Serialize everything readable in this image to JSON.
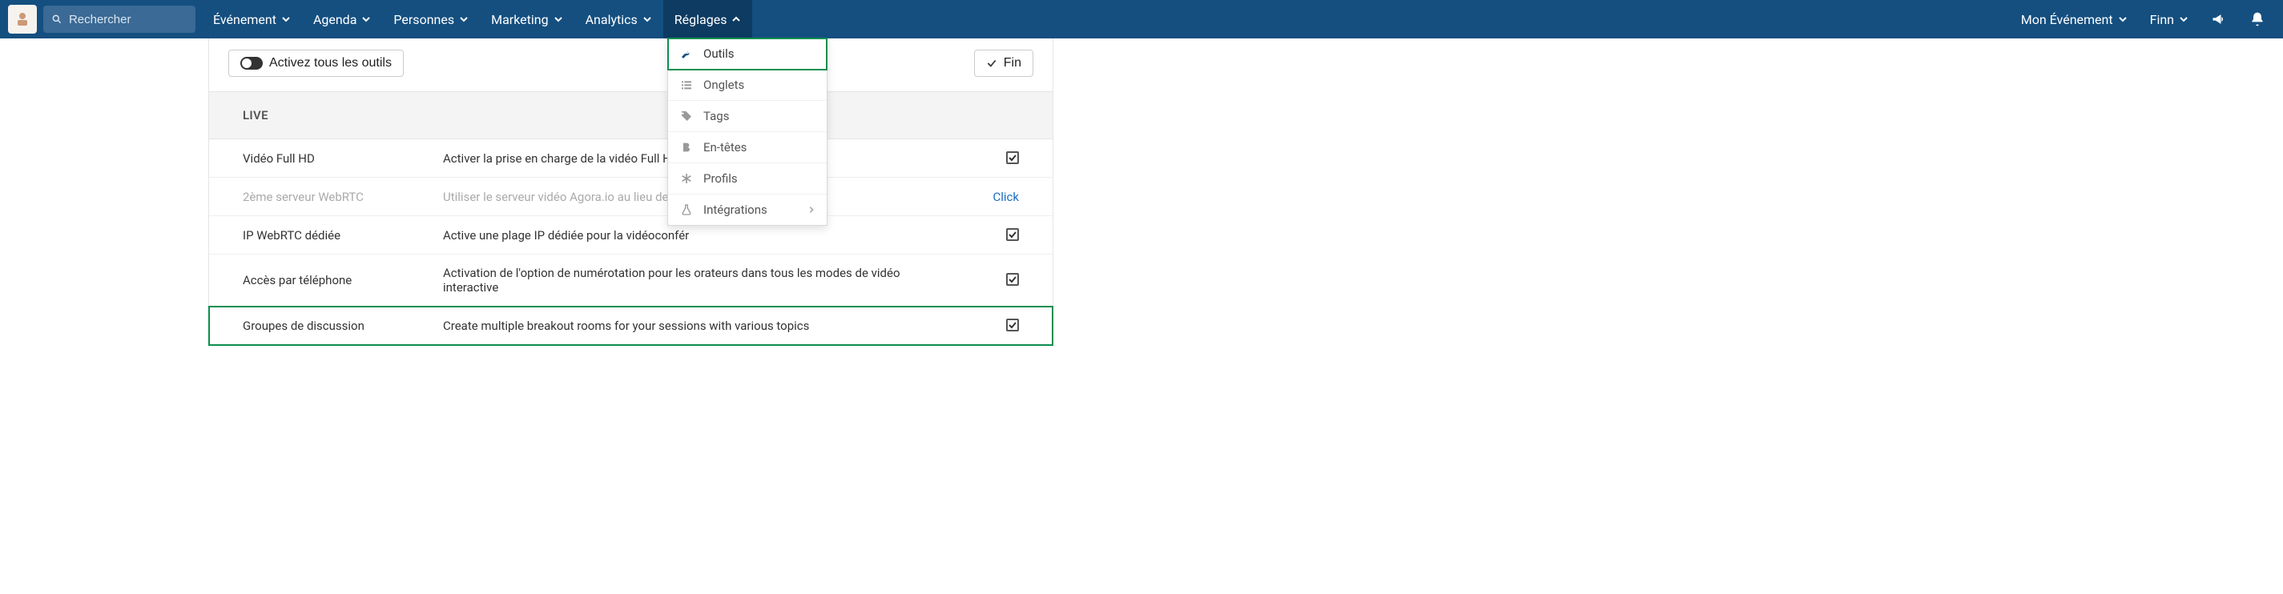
{
  "nav": {
    "search_placeholder": "Rechercher",
    "items": [
      {
        "label": "Événement"
      },
      {
        "label": "Agenda"
      },
      {
        "label": "Personnes"
      },
      {
        "label": "Marketing"
      },
      {
        "label": "Analytics"
      },
      {
        "label": "Réglages"
      }
    ],
    "right": {
      "event": "Mon Événement",
      "user": "Finn"
    }
  },
  "toolbar": {
    "activate_all": "Activez tous les outils",
    "finish": "Fin"
  },
  "section_title": "LIVE",
  "rows": [
    {
      "name": "Vidéo Full HD",
      "desc": "Activer la prise en charge de la vidéo Full HD p                                            virtuel",
      "checked": true
    },
    {
      "name": "2ème serveur WebRTC",
      "desc": "Utiliser le serveur vidéo Agora.io au lieu de Tok",
      "link": "Click",
      "disabled": true
    },
    {
      "name": "IP WebRTC dédiée",
      "desc": "Active une plage IP dédiée pour la vidéoconfér",
      "checked": true
    },
    {
      "name": "Accès par téléphone",
      "desc": "Activation de l'option de numérotation pour les orateurs dans tous les modes de vidéo interactive",
      "checked": true
    },
    {
      "name": "Groupes de discussion",
      "desc": "Create multiple breakout rooms for your sessions with various topics",
      "checked": true,
      "highlight": true
    }
  ],
  "dropdown": [
    {
      "icon": "wrench",
      "label": "Outils",
      "active": true
    },
    {
      "icon": "list",
      "label": "Onglets"
    },
    {
      "icon": "tag",
      "label": "Tags"
    },
    {
      "icon": "bold",
      "label": "En-têtes"
    },
    {
      "icon": "asterisk",
      "label": "Profils"
    },
    {
      "icon": "flask",
      "label": "Intégrations",
      "sub": true
    }
  ]
}
